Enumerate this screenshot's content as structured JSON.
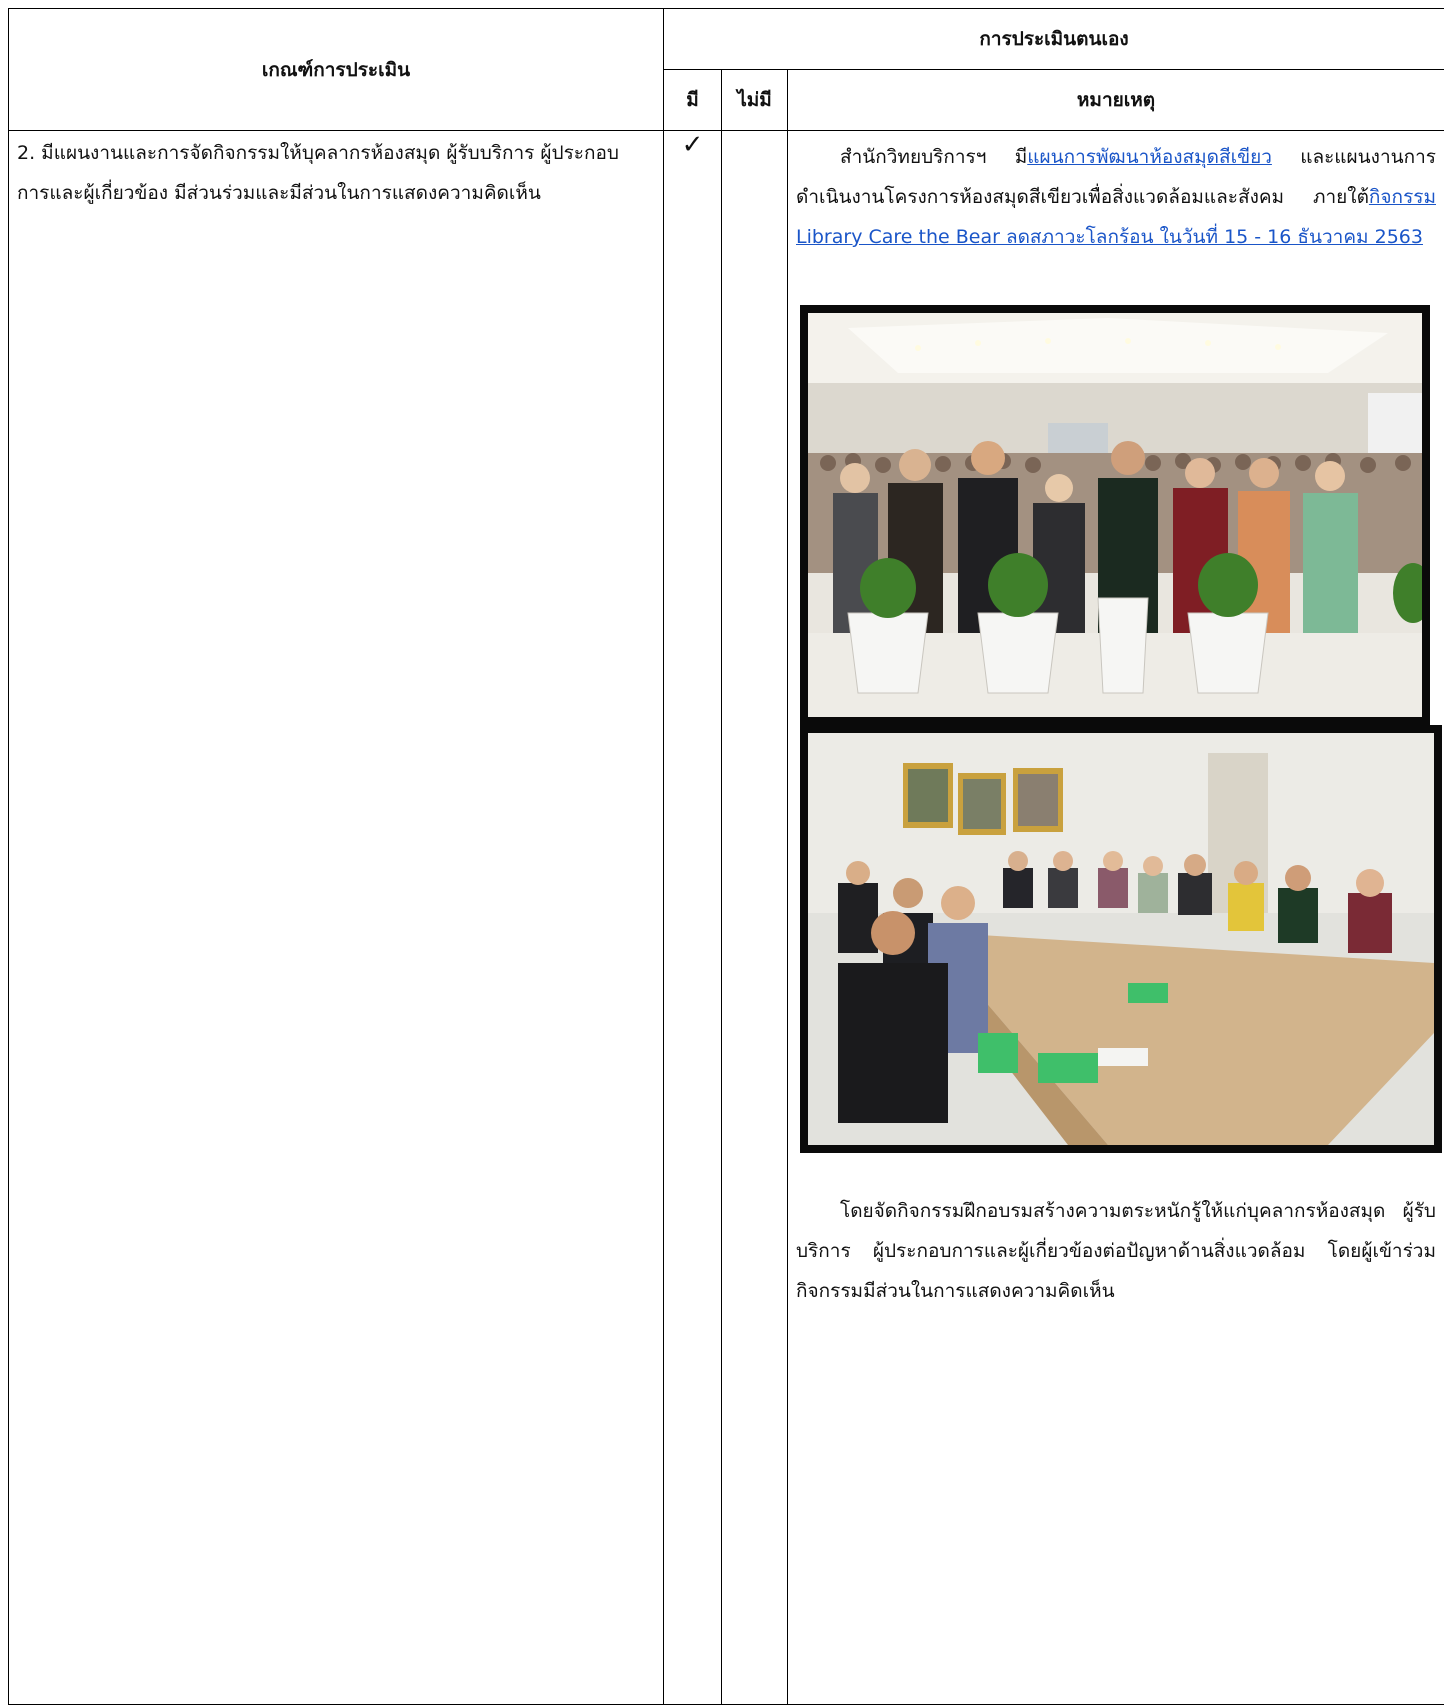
{
  "table": {
    "col_criteria_header": "เกณฑ์การประเมิน",
    "col_self_assessment_header": "การประเมินตนเอง",
    "col_have_header": "มี",
    "col_have_not_header": "ไม่มี",
    "col_remarks_header": "หมายเหตุ"
  },
  "row": {
    "criteria": "2. มีแผนงานและการจัดกิจกรรมให้บุคลากรห้องสมุด ผู้รับบริการ ผู้ประกอบการและผู้เกี่ยวข้อง มีส่วนร่วมและมีส่วนในการแสดงความคิดเห็น",
    "have_mark": "✓",
    "have_not_mark": "",
    "remarks": {
      "intro_prefix": "สำนักวิทยบริการฯ มี",
      "plan_link": "แผนการพัฒนาห้องสมุดสีเขียว",
      "intro_middle": " และแผนงานการดำเนินงานโครงการห้องสมุดสีเขียวเพื่อสิ่งแวดล้อมและสังคม ภายใต้",
      "activity_link": "กิจกรรม Library Care the Bear ลดสภาวะโลกร้อน ในวันที่ 15 - 16 ธันวาคม 2563",
      "closing": "โดยจัดกิจกรรมฝึกอบรมสร้างความตระหนักรู้ให้แก่บุคลากรห้องสมุด ผู้รับบริการ ผู้ประกอบการและผู้เกี่ยวข้องต่อปัญหาด้านสิ่งแวดล้อม โดยผู้เข้าร่วมกิจกรรมมีส่วนในการแสดงความคิดเห็น"
    }
  },
  "colors": {
    "border": "#000000",
    "link": "#1a55c8"
  }
}
